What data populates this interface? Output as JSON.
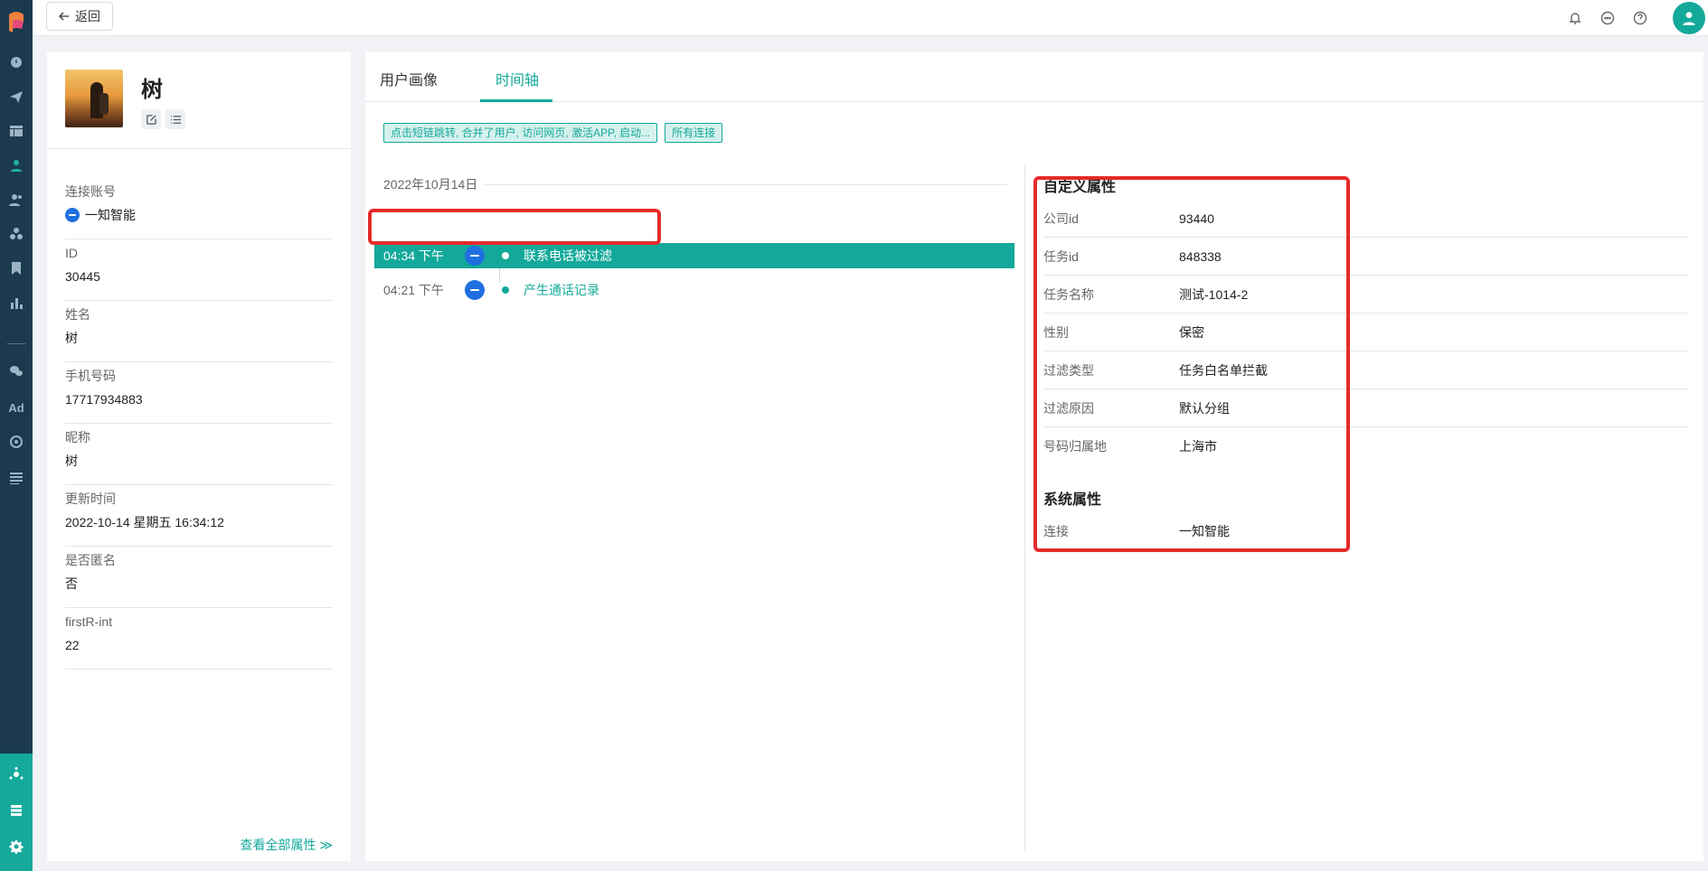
{
  "topbar": {
    "back_label": "返回"
  },
  "profile": {
    "name": "树",
    "fields": [
      {
        "label": "连接账号",
        "value": "一知智能",
        "with_logo": true
      },
      {
        "label": "ID",
        "value": "30445"
      },
      {
        "label": "姓名",
        "value": "树"
      },
      {
        "label": "手机号码",
        "value": "17717934883"
      },
      {
        "label": "昵称",
        "value": "树"
      },
      {
        "label": "更新时间",
        "value": "2022-10-14 星期五 16:34:12"
      },
      {
        "label": "是否匿名",
        "value": "否"
      },
      {
        "label": "firstR-int",
        "value": "22"
      }
    ],
    "view_all": "查看全部属性 ≫"
  },
  "tabs": [
    {
      "label": "用户画像",
      "active": false
    },
    {
      "label": "时间轴",
      "active": true
    }
  ],
  "filters": [
    "点击短链跳转, 合并了用户, 访问网页, 激活APP, 启动...",
    "所有连接"
  ],
  "timeline": {
    "date": "2022年10月14日",
    "events": [
      {
        "time": "04:34 下午",
        "title": "联系电话被过滤",
        "selected": true
      },
      {
        "time": "04:21 下午",
        "title": "产生通话记录",
        "selected": false
      }
    ]
  },
  "custom_attrs": {
    "title": "自定义属性",
    "rows": [
      {
        "key": "公司id",
        "value": "93440"
      },
      {
        "key": "任务id",
        "value": "848338"
      },
      {
        "key": "任务名称",
        "value": "测试-1014-2"
      },
      {
        "key": "性别",
        "value": "保密"
      },
      {
        "key": "过滤类型",
        "value": "任务白名单拦截"
      },
      {
        "key": "过滤原因",
        "value": "默认分组"
      },
      {
        "key": "号码归属地",
        "value": "上海市"
      }
    ]
  },
  "system_attrs": {
    "title": "系统属性",
    "rows": [
      {
        "key": "连接",
        "value": "一知智能"
      }
    ]
  },
  "colors": {
    "accent": "#13a99a",
    "rail": "#1c3a4f",
    "highlight": "#e52a2a"
  },
  "icons": {
    "rail": [
      "dashboard-icon",
      "send-icon",
      "table-icon",
      "user-icon",
      "users-icon",
      "group-icon",
      "bookmark-icon",
      "bar-chart-icon",
      "wechat-icon",
      "ad-icon",
      "target-icon",
      "list-icon"
    ],
    "top": [
      "bell-icon",
      "chat-icon",
      "help-icon",
      "avatar-icon"
    ]
  }
}
